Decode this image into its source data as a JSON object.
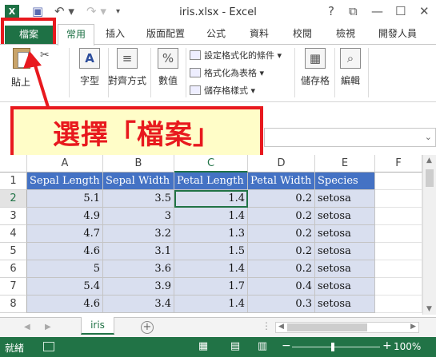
{
  "titlebar": {
    "app_icon": "excel-logo-icon",
    "app_icon_text": "X",
    "title": "iris.xlsx - Excel",
    "help": "?",
    "restore": "⧉",
    "minimize": "—",
    "maximize": "☐",
    "close": "✕"
  },
  "tabs": {
    "file": "檔案",
    "items": [
      "常用",
      "插入",
      "版面配置",
      "公式",
      "資料",
      "校閱",
      "檢視",
      "開發人員"
    ]
  },
  "ribbon": {
    "paste": "貼上",
    "font": "字型",
    "alignment": "對齊方式",
    "number": "數值",
    "conditional_format": "設定格式化的條件",
    "format_as_table": "格式化為表格",
    "cell_styles": "儲存格樣式",
    "cells": "儲存格",
    "editing": "編輯"
  },
  "callout": {
    "text": "選擇「檔案」"
  },
  "grid": {
    "columns": [
      "A",
      "B",
      "C",
      "D",
      "E",
      "F"
    ],
    "rows": [
      "1",
      "2",
      "3",
      "4",
      "5",
      "6",
      "7",
      "8"
    ],
    "header": [
      "Sepal Length",
      "Sepal Width",
      "Petal Length",
      "Petal Width",
      "Species"
    ],
    "data": [
      [
        "5.1",
        "3.5",
        "1.4",
        "0.2",
        "setosa"
      ],
      [
        "4.9",
        "3",
        "1.4",
        "0.2",
        "setosa"
      ],
      [
        "4.7",
        "3.2",
        "1.3",
        "0.2",
        "setosa"
      ],
      [
        "4.6",
        "3.1",
        "1.5",
        "0.2",
        "setosa"
      ],
      [
        "5",
        "3.6",
        "1.4",
        "0.2",
        "setosa"
      ],
      [
        "5.4",
        "3.9",
        "1.7",
        "0.4",
        "setosa"
      ],
      [
        "4.6",
        "3.4",
        "1.4",
        "0.3",
        "setosa"
      ]
    ],
    "selected_cell": "C2"
  },
  "sheetbar": {
    "sheet_name": "iris",
    "add_sheet": "+"
  },
  "statusbar": {
    "ready": "就緒",
    "zoom": "100%",
    "zoom_minus": "−",
    "zoom_plus": "+"
  },
  "colors": {
    "excel_green": "#217346",
    "header_fill": "#4472c4",
    "data_fill": "#d9dfef",
    "callout_red": "#e8191e",
    "callout_bg": "#fffdc8"
  }
}
